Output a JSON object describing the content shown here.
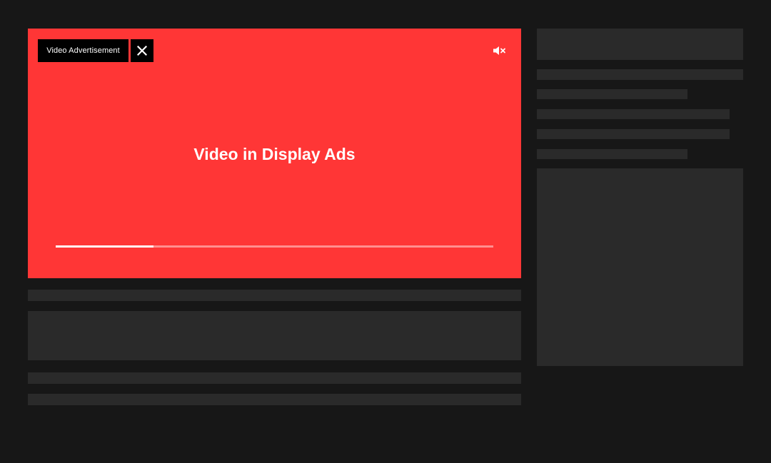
{
  "ad": {
    "label": "Video Advertisement",
    "title": "Video in Display Ads",
    "progress_percent": 22.4,
    "close_icon": "close-icon",
    "mute_icon": "volume-muted-icon",
    "background_color": "#ff3636"
  },
  "page": {
    "background_color": "#171717",
    "placeholder_color": "#2a2a2a"
  }
}
